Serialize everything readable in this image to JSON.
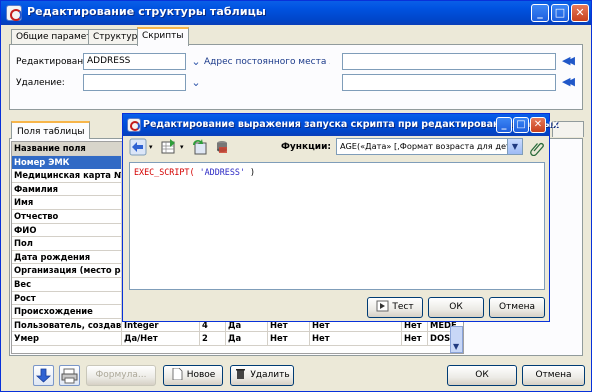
{
  "window": {
    "title": "Редактирование структуры таблицы",
    "controls": {
      "minimize": "_",
      "maximize": "□",
      "close": "✕"
    }
  },
  "tabs": [
    "Общие параметры",
    "Структура",
    "Скрипты"
  ],
  "scripts": {
    "edit_label": "Редактирование:",
    "edit_value": "ADDRESS",
    "permanent_address": "Адрес постоянного места ж...",
    "delete_label": "Удаление:",
    "delete_value": "",
    "right_field_1": "",
    "right_field_2": ""
  },
  "lower_tab": "Поля таблицы",
  "table": {
    "header": "Название поля",
    "rows": [
      [
        "Номер ЭМК",
        "",
        "",
        "",
        "",
        "",
        "",
        ""
      ],
      [
        "Медицинская карта №",
        "",
        "",
        "",
        "",
        "",
        "",
        ""
      ],
      [
        "Фамилия",
        "",
        "",
        "",
        "",
        "",
        "",
        ""
      ],
      [
        "Имя",
        "",
        "",
        "",
        "",
        "",
        "",
        ""
      ],
      [
        "Отчество",
        "",
        "",
        "",
        "",
        "",
        "",
        ""
      ],
      [
        "ФИО",
        "",
        "",
        "",
        "",
        "",
        "",
        ""
      ],
      [
        "Пол",
        "",
        "",
        "",
        "",
        "",
        "",
        ""
      ],
      [
        "Дата рождения",
        "",
        "",
        "",
        "",
        "",
        "",
        ""
      ],
      [
        "Организация (место работы",
        "",
        "",
        "",
        "",
        "",
        "",
        ""
      ],
      [
        "Вес",
        "",
        "",
        "",
        "",
        "",
        "",
        ""
      ],
      [
        "Рост",
        "",
        "",
        "",
        "",
        "",
        "",
        ""
      ],
      [
        "Происхождение",
        "",
        "",
        "",
        "",
        "",
        "",
        ""
      ],
      [
        "Пользователь, создавший",
        "Integer",
        "4",
        "Да",
        "Нет",
        "Нет",
        "Нет",
        "MEDE"
      ],
      [
        "Умер",
        "Да/Нет",
        "2",
        "Да",
        "Нет",
        "Нет",
        "Нет",
        "DOSS"
      ]
    ],
    "selected_row": 0
  },
  "bottom": {
    "formula": "Формула...",
    "new": "Новое",
    "delete": "Удалить",
    "ok": "ОК",
    "cancel": "Отмена"
  },
  "dialog": {
    "title": "Редактирование выражения запуска скрипта при редактировании данных",
    "functions_label": "Функции:",
    "function_value": "AGE(«Дата» [,Формат возраста для детей])",
    "code_keyword": "EXEC_SCRIPT(",
    "code_string": "'ADDRESS'",
    "code_tail": " )",
    "test": "Тест",
    "ok": "ОК",
    "cancel": "Отмена"
  },
  "colors": {
    "title_bar": "#0053e1",
    "selection": "#316ac5",
    "keyword": "#d40000",
    "string": "#2b28c4"
  }
}
